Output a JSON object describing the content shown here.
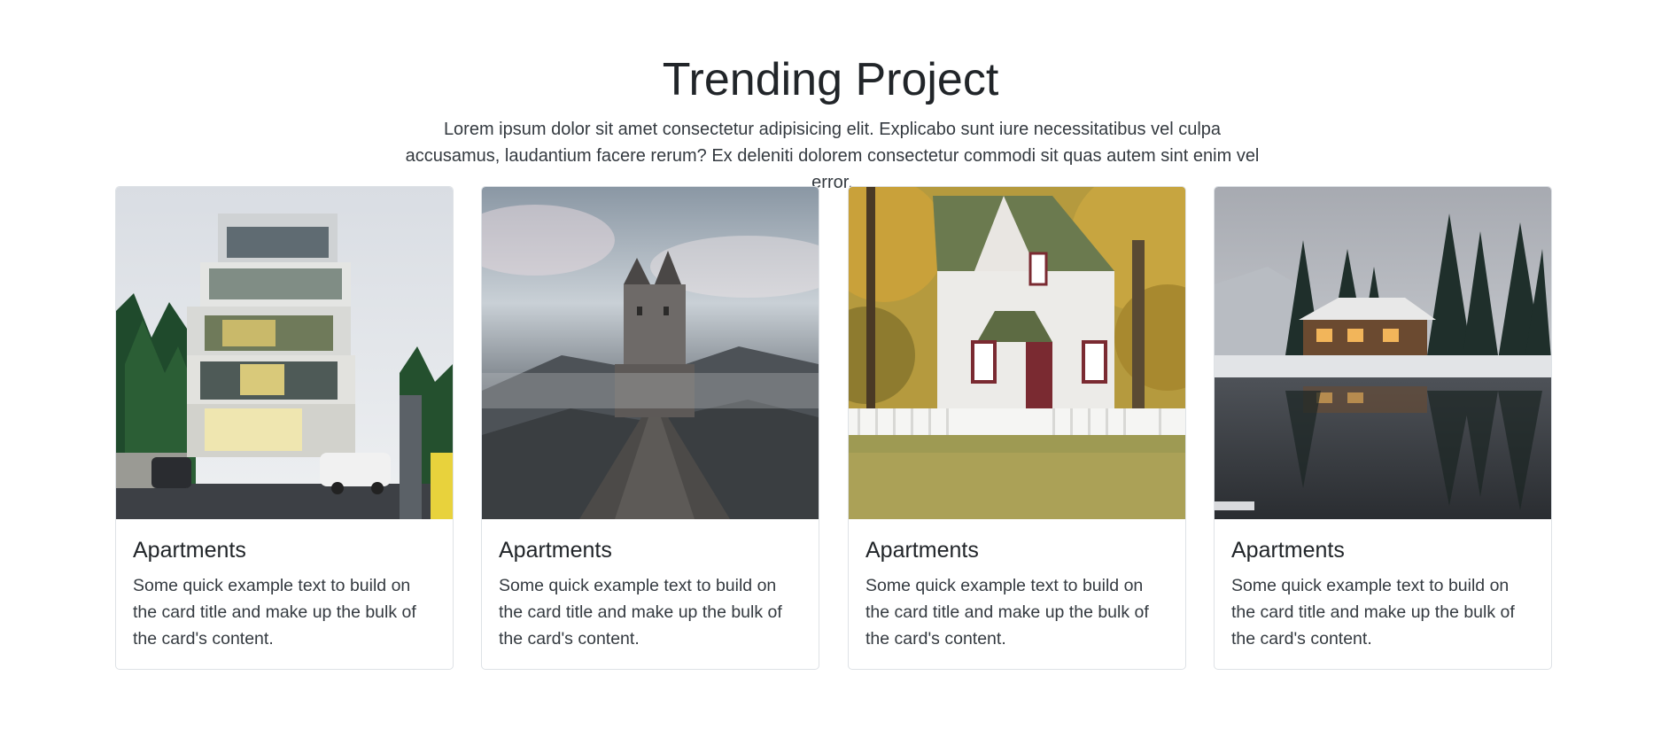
{
  "section": {
    "title": "Trending Project",
    "lead": "Lorem ipsum dolor sit amet consectetur adipisicing elit. Explicabo sunt iure necessitatibus vel culpa accusamus, laudantium facere rerum? Ex deleniti dolorem consectetur commodi sit quas autem sint enim vel error."
  },
  "cards": [
    {
      "title": "Apartments",
      "text": "Some quick example text to build on the card title and make up the bulk of the card's content.",
      "image": "modern-apartment-building-photo"
    },
    {
      "title": "Apartments",
      "text": "Some quick example text to build on the card title and make up the bulk of the card's content.",
      "image": "misty-castle-photo"
    },
    {
      "title": "Apartments",
      "text": "Some quick example text to build on the card title and make up the bulk of the card's content.",
      "image": "white-house-autumn-photo"
    },
    {
      "title": "Apartments",
      "text": "Some quick example text to build on the card title and make up the bulk of the card's content.",
      "image": "lake-cabin-winter-photo"
    }
  ],
  "colors": {
    "text": "#212529",
    "border": "#dee2e6"
  }
}
